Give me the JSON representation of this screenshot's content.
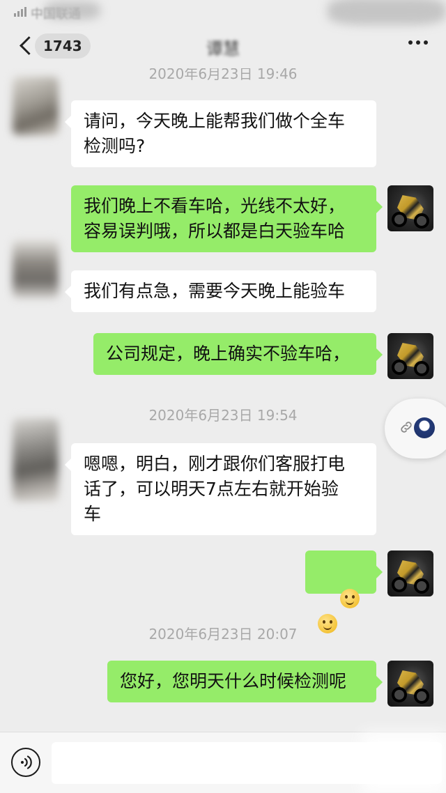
{
  "status_bar": {
    "carrier": "中国联通"
  },
  "nav": {
    "unread_count": "1743",
    "title": "谭慧"
  },
  "messages": [
    {
      "type": "timestamp",
      "text": "2020年6月23日 19:46"
    },
    {
      "type": "received",
      "text": "请问，今天晚上能帮我们做个全车\n检测吗?"
    },
    {
      "type": "sent",
      "text": "我们晚上不看车哈，光线不太好，\n容易误判哦，所以都是白天验车哈"
    },
    {
      "type": "received",
      "text": "我们有点急，需要今天晚上能验车"
    },
    {
      "type": "sent",
      "text": "公司规定，晚上确实不验车哈，"
    },
    {
      "type": "timestamp",
      "text": "2020年6月23日 19:54"
    },
    {
      "type": "received",
      "text": "嗯嗯，明白，刚才跟你们客服打电\n话了，可以明天7点左右就开始验\n车"
    },
    {
      "type": "sent",
      "emoji": [
        "slightly-smiling-face",
        "slightly-smiling-face"
      ]
    },
    {
      "type": "timestamp",
      "text": "2020年6月23日 20:07"
    },
    {
      "type": "sent",
      "text": "您好，您明天什么时候检测呢"
    }
  ],
  "colors": {
    "sent_bubble": "#95ec69",
    "received_bubble": "#ffffff",
    "background": "#ededed"
  },
  "input": {
    "value": "",
    "placeholder": ""
  },
  "icons": [
    "back-chevron-icon",
    "more-dots-icon",
    "voice-icon",
    "link-icon",
    "smile-emoji-icon"
  ]
}
